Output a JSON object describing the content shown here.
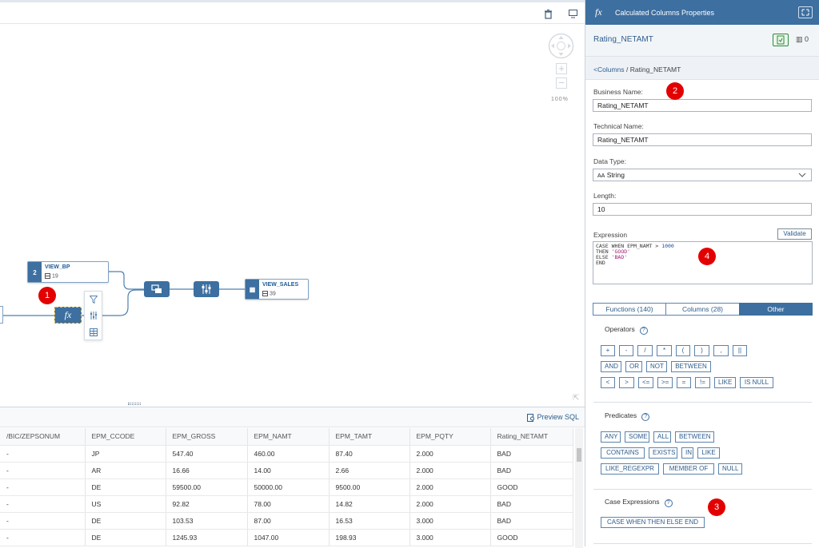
{
  "canvas": {
    "zoom": "100%",
    "nodes": {
      "view_bp": {
        "badge": "2",
        "name": "VIEW_BP",
        "count": "19"
      },
      "view_sales": {
        "name": "VIEW_SALES",
        "count": "39"
      },
      "calc": {
        "label": "fx"
      }
    },
    "callouts": [
      "1",
      "2",
      "3",
      "4"
    ]
  },
  "grid": {
    "preview_sql": "Preview SQL",
    "columns": [
      "/BIC/ZEPSONUM",
      "EPM_CCODE",
      "EPM_GROSS",
      "EPM_NAMT",
      "EPM_TAMT",
      "EPM_PQTY",
      "Rating_NETAMT"
    ],
    "rows": [
      [
        "-",
        "JP",
        "547.40",
        "460.00",
        "87.40",
        "2.000",
        "BAD"
      ],
      [
        "-",
        "AR",
        "16.66",
        "14.00",
        "2.66",
        "2.000",
        "BAD"
      ],
      [
        "-",
        "DE",
        "59500.00",
        "50000.00",
        "9500.00",
        "2.000",
        "GOOD"
      ],
      [
        "-",
        "US",
        "92.82",
        "78.00",
        "14.82",
        "2.000",
        "BAD"
      ],
      [
        "-",
        "DE",
        "103.53",
        "87.00",
        "16.53",
        "3.000",
        "BAD"
      ],
      [
        "-",
        "DE",
        "1245.93",
        "1047.00",
        "198.93",
        "3.000",
        "GOOD"
      ]
    ]
  },
  "panel": {
    "title": "Calculated Columns Properties",
    "fx": "fx",
    "column_name": "Rating_NETAMT",
    "count": "0",
    "breadcrumb_link": "<Columns",
    "breadcrumb_rest": " / Rating_NETAMT",
    "business_name_label": "Business Name:",
    "business_name": "Rating_NETAMT",
    "technical_name_label": "Technical Name:",
    "technical_name": "Rating_NETAMT",
    "data_type_label": "Data Type:",
    "data_type": "String",
    "data_type_icon": "AA",
    "length_label": "Length:",
    "length": "10",
    "expression_label": "Expression",
    "validate": "Validate",
    "expression_lines": [
      "CASE WHEN EPM_NAMT > 1000",
      "THEN 'GOOD'",
      "ELSE 'BAD'",
      "END"
    ],
    "tabs": [
      "Functions (140)",
      "Columns (28)",
      "Other"
    ],
    "operators_label": "Operators",
    "operators_row1": [
      "+",
      "-",
      "/",
      "*",
      "(",
      ")",
      ",",
      "||"
    ],
    "operators_row2": [
      "AND",
      "OR",
      "NOT",
      "BETWEEN"
    ],
    "operators_row3": [
      "<",
      ">",
      "<=",
      ">=",
      "=",
      "!=",
      "LIKE",
      "IS NULL"
    ],
    "predicates_label": "Predicates",
    "predicates_row1": [
      "ANY",
      "SOME",
      "ALL",
      "BETWEEN"
    ],
    "predicates_row2": [
      "CONTAINS",
      "EXISTS",
      "IN",
      "LIKE"
    ],
    "predicates_row3": [
      "LIKE_REGEXPR",
      "MEMBER OF",
      "NULL"
    ],
    "case_label": "Case Expressions",
    "case_button": "CASE WHEN THEN ELSE END"
  }
}
